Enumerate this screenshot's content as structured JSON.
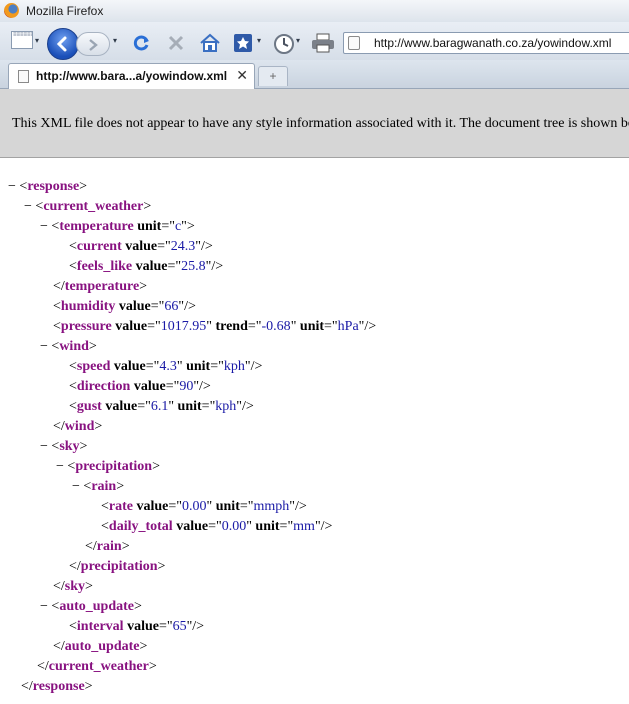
{
  "window": {
    "title": "Mozilla Firefox"
  },
  "toolbar": {
    "url": "http://www.baragwanath.co.za/yowindow.xml",
    "icons": [
      "menu-icon",
      "back-icon",
      "forward-icon",
      "dropdown-icon",
      "reload-icon",
      "stop-icon",
      "home-icon",
      "bookmark-icon",
      "history-icon",
      "print-icon",
      "page-icon"
    ]
  },
  "tab": {
    "title": "http://www.bara...a/yowindow.xml",
    "close": "✕",
    "new_tab": "+"
  },
  "banner": {
    "text": "This XML file does not appear to have any style information associated with it. The document tree is shown below."
  },
  "xml": {
    "response": "response",
    "current_weather": "current_weather",
    "temperature": "temperature",
    "temperature_unit": "c",
    "current": "current",
    "current_value": "24.3",
    "feels_like": "feels_like",
    "feels_like_value": "25.8",
    "humidity": "humidity",
    "humidity_value": "66",
    "pressure": "pressure",
    "pressure_value": "1017.95",
    "pressure_trend": "-0.68",
    "pressure_unit": "hPa",
    "wind": "wind",
    "speed": "speed",
    "speed_value": "4.3",
    "speed_unit": "kph",
    "direction": "direction",
    "direction_value": "90",
    "gust": "gust",
    "gust_value": "6.1",
    "gust_unit": "kph",
    "sky": "sky",
    "precipitation": "precipitation",
    "rain": "rain",
    "rate": "rate",
    "rate_value": "0.00",
    "rate_unit": "mmph",
    "daily_total": "daily_total",
    "daily_total_value": "0.00",
    "daily_total_unit": "mm",
    "auto_update": "auto_update",
    "interval": "interval",
    "interval_value": "65",
    "attr_unit": "unit",
    "attr_value": "value",
    "attr_trend": "trend",
    "collapse": "−"
  }
}
